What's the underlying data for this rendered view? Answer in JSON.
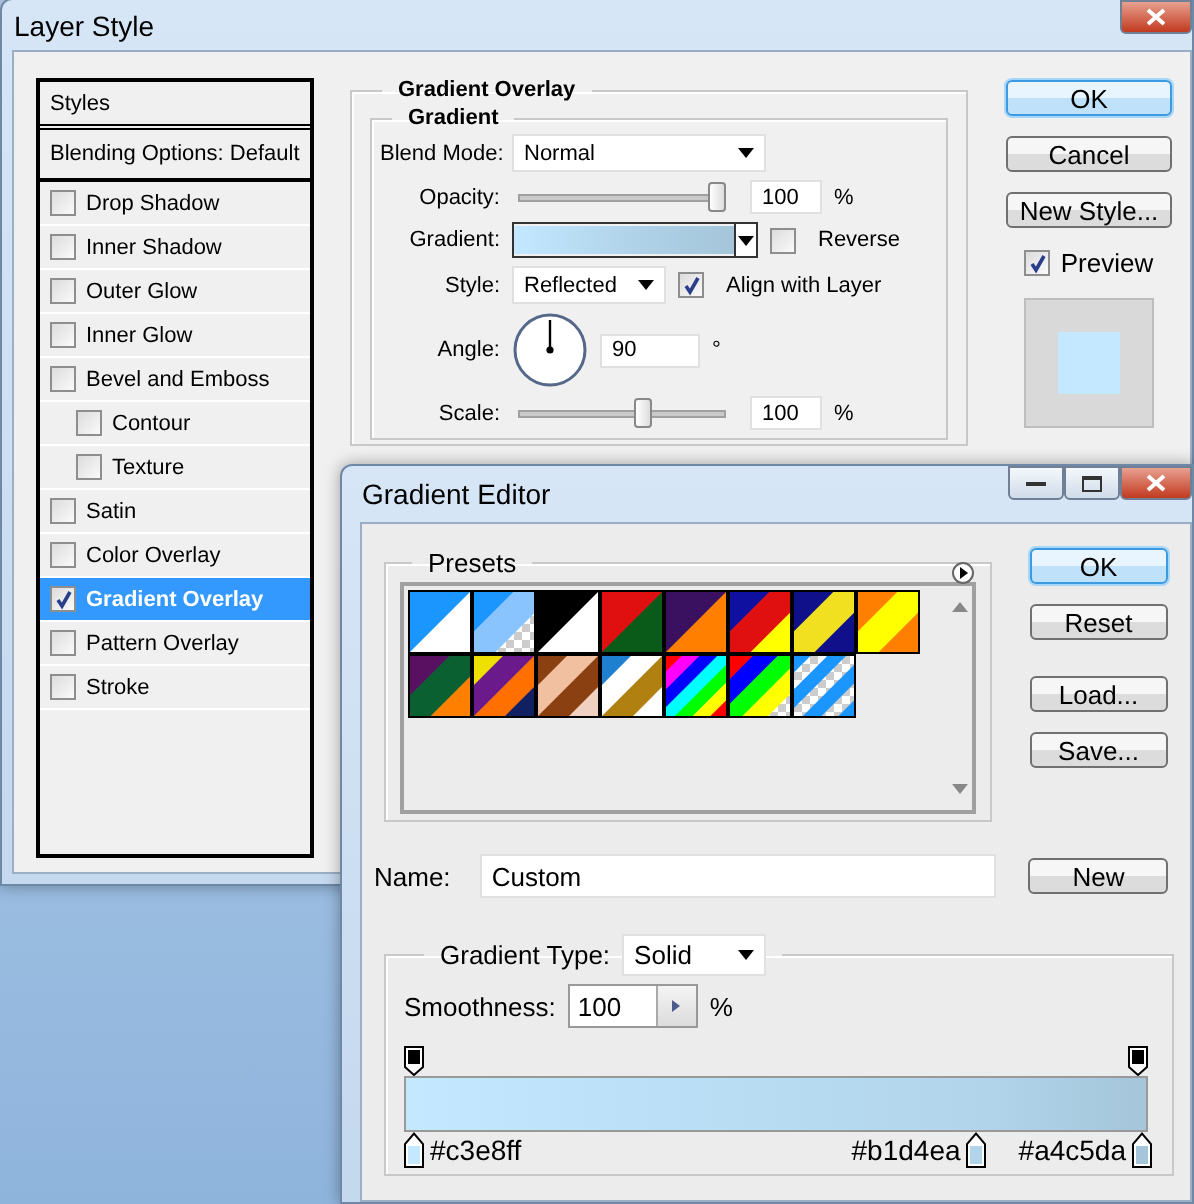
{
  "layer_style": {
    "title": "Layer Style",
    "styles": [
      {
        "label": "Styles",
        "kind": "header",
        "selected": false
      },
      {
        "label": "Blending Options: Default",
        "kind": "option",
        "selected": false
      },
      {
        "label": "Drop Shadow",
        "kind": "effect",
        "checked": false,
        "selected": false
      },
      {
        "label": "Inner Shadow",
        "kind": "effect",
        "checked": false,
        "selected": false
      },
      {
        "label": "Outer Glow",
        "kind": "effect",
        "checked": false,
        "selected": false
      },
      {
        "label": "Inner Glow",
        "kind": "effect",
        "checked": false,
        "selected": false
      },
      {
        "label": "Bevel and Emboss",
        "kind": "effect",
        "checked": false,
        "selected": false,
        "children": [
          {
            "label": "Contour",
            "kind": "effect",
            "checked": false,
            "selected": false
          },
          {
            "label": "Texture",
            "kind": "effect",
            "checked": false,
            "selected": false
          }
        ]
      },
      {
        "label": "Satin",
        "kind": "effect",
        "checked": false,
        "selected": false
      },
      {
        "label": "Color Overlay",
        "kind": "effect",
        "checked": false,
        "selected": false
      },
      {
        "label": "Gradient Overlay",
        "kind": "effect",
        "checked": true,
        "selected": true
      },
      {
        "label": "Pattern Overlay",
        "kind": "effect",
        "checked": false,
        "selected": false
      },
      {
        "label": "Stroke",
        "kind": "effect",
        "checked": false,
        "selected": false
      }
    ],
    "gradient_overlay": {
      "title": "Gradient Overlay",
      "section": "Gradient",
      "blend_mode": {
        "label": "Blend Mode:",
        "value": "Normal"
      },
      "opacity": {
        "label": "Opacity:",
        "level": 0.95,
        "value": "100",
        "unit": "%"
      },
      "gradient": {
        "label": "Gradient:"
      },
      "reverse": {
        "label": "Reverse",
        "checked": false
      },
      "style": {
        "label": "Style:",
        "value": "Reflected"
      },
      "align_with_layer": {
        "label": "Align with Layer",
        "checked": true
      },
      "angle": {
        "label": "Angle:",
        "value": "90",
        "unit": "°"
      },
      "scale": {
        "label": "Scale:",
        "level": 0.6,
        "value": "100",
        "unit": "%"
      }
    },
    "buttons": [
      {
        "label": "OK",
        "default": true
      },
      {
        "label": "Cancel",
        "default": false
      },
      {
        "label": "New Style...",
        "default": false
      }
    ],
    "preview": {
      "label": "Preview",
      "checked": true,
      "color": "#c3e8ff"
    }
  },
  "gradient_editor": {
    "title": "Gradient Editor",
    "presets_label": "Presets",
    "presets": [
      {
        "kind": "foreground_background"
      },
      {
        "kind": "foreground_transparent"
      },
      {
        "kind": "black_white"
      },
      {
        "kind": "red_green"
      },
      {
        "kind": "violet_orange"
      },
      {
        "kind": "blue_red_yellow"
      },
      {
        "kind": "blue_yellow_blue"
      },
      {
        "kind": "orange_yellow_orange"
      },
      {
        "kind": "violet_green_orange"
      },
      {
        "kind": "yellow_violet_orange_blue"
      },
      {
        "kind": "copper"
      },
      {
        "kind": "chrome"
      },
      {
        "kind": "spectrum"
      },
      {
        "kind": "transparent_rainbow"
      },
      {
        "kind": "transparent_stripes"
      }
    ],
    "buttons": [
      {
        "label": "OK",
        "default": true
      },
      {
        "label": "Reset",
        "default": false
      },
      {
        "label": "Load...",
        "default": false
      },
      {
        "label": "Save...",
        "default": false
      }
    ],
    "name": {
      "label": "Name:",
      "value": "Custom"
    },
    "new_button": "New",
    "gradient_type": {
      "label": "Gradient Type:",
      "value": "Solid"
    },
    "smoothness": {
      "label": "Smoothness:",
      "value": "100",
      "unit": "%"
    },
    "color_stops": [
      {
        "label": "#c3e8ff",
        "color": "#c3e8ff"
      },
      {
        "label": "#b1d4ea",
        "color": "#b1d4ea"
      },
      {
        "label": "#a4c5da",
        "color": "#a4c5da"
      }
    ]
  }
}
